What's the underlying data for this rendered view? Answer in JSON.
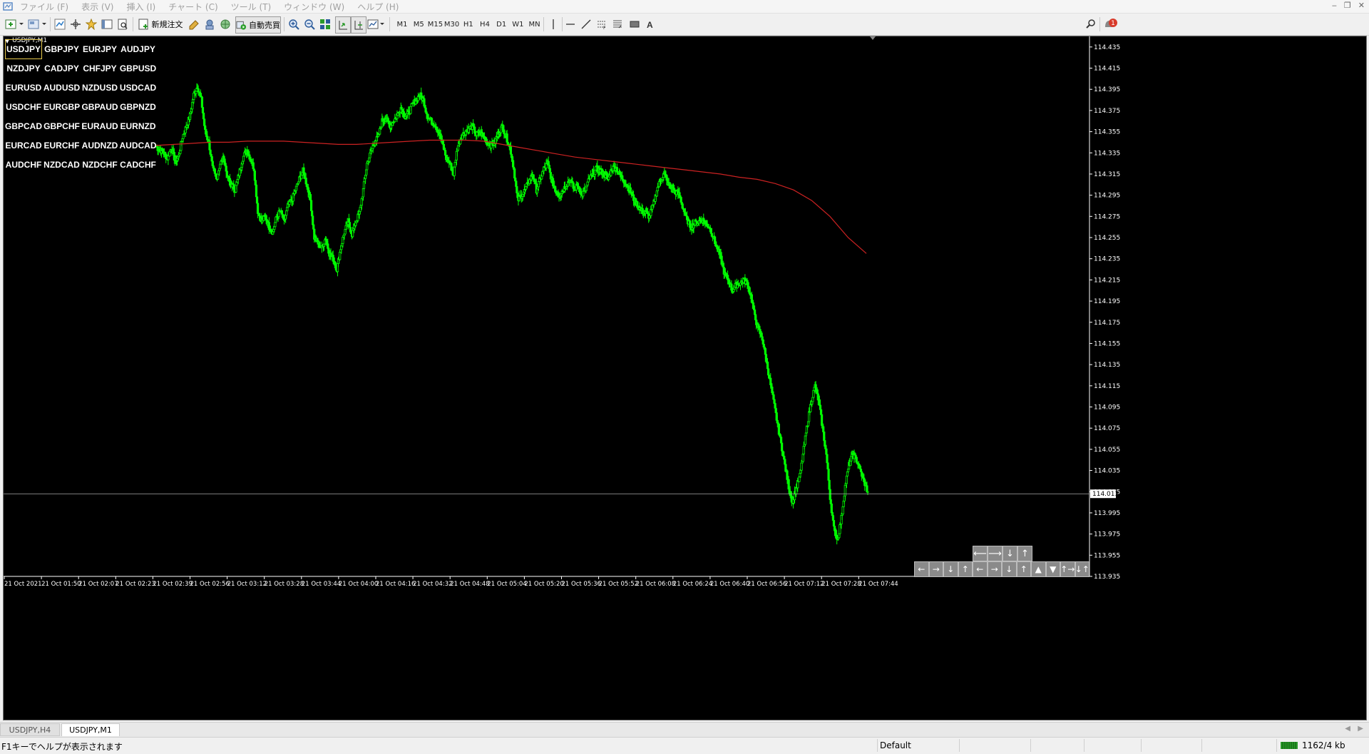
{
  "menus": [
    "ファイル (F)",
    "表示 (V)",
    "挿入 (I)",
    "チャート (C)",
    "ツール (T)",
    "ウィンドウ (W)",
    "ヘルプ (H)"
  ],
  "toolbar": {
    "new_order_label": "新規注文",
    "auto_trade_label": "自動売買",
    "timeframes": [
      "M1",
      "M5",
      "M15",
      "M30",
      "H1",
      "H4",
      "D1",
      "W1",
      "MN"
    ],
    "notification_count": "1"
  },
  "chart": {
    "title": "USDJPY,M1",
    "current_price": "114.013",
    "price_ticks": [
      "114.435",
      "114.415",
      "114.395",
      "114.375",
      "114.355",
      "114.335",
      "114.315",
      "114.295",
      "114.275",
      "114.255",
      "114.235",
      "114.215",
      "114.195",
      "114.175",
      "114.155",
      "114.135",
      "114.115",
      "114.095",
      "114.075",
      "114.055",
      "114.035",
      "114.015",
      "113.995",
      "113.975",
      "113.955",
      "113.935"
    ],
    "time_ticks": [
      "21 Oct 2021",
      "21 Oct 01:50",
      "21 Oct 02:07",
      "21 Oct 02:23",
      "21 Oct 02:39",
      "21 Oct 02:56",
      "21 Oct 03:12",
      "21 Oct 03:28",
      "21 Oct 03:44",
      "21 Oct 04:00",
      "21 Oct 04:16",
      "21 Oct 04:32",
      "21 Oct 04:48",
      "21 Oct 05:04",
      "21 Oct 05:20",
      "21 Oct 05:36",
      "21 Oct 05:52",
      "21 Oct 06:08",
      "21 Oct 06:24",
      "21 Oct 06:40",
      "21 Oct 06:56",
      "21 Oct 07:12",
      "21 Oct 07:28",
      "21 Oct 07:44"
    ],
    "candle_color": "#00ff00",
    "ma_color": "#cc2222",
    "price_path": [
      114.341,
      114.338,
      114.335,
      114.33,
      114.34,
      114.328,
      114.332,
      114.35,
      114.36,
      114.37,
      114.39,
      114.398,
      114.385,
      114.355,
      114.345,
      114.32,
      114.31,
      114.325,
      114.33,
      114.31,
      114.305,
      114.3,
      114.315,
      114.33,
      114.338,
      114.33,
      114.32,
      114.28,
      114.27,
      114.275,
      114.265,
      114.26,
      114.275,
      114.28,
      114.27,
      114.285,
      114.29,
      114.3,
      114.31,
      114.318,
      114.305,
      114.29,
      114.255,
      114.25,
      114.245,
      114.255,
      114.24,
      114.235,
      114.225,
      114.245,
      114.26,
      114.27,
      114.258,
      114.27,
      114.278,
      114.3,
      114.325,
      114.335,
      114.345,
      114.35,
      114.365,
      114.368,
      114.36,
      114.365,
      114.37,
      114.378,
      114.37,
      114.372,
      114.38,
      114.385,
      114.39,
      114.385,
      114.37,
      114.365,
      114.362,
      114.355,
      114.345,
      114.33,
      114.325,
      114.315,
      114.34,
      114.35,
      114.355,
      114.358,
      114.36,
      114.352,
      114.355,
      114.35,
      114.345,
      114.342,
      114.345,
      114.355,
      114.36,
      114.35,
      114.34,
      114.32,
      114.29,
      114.295,
      114.3,
      114.308,
      114.315,
      114.3,
      114.31,
      114.32,
      114.325,
      114.31,
      114.3,
      114.295,
      114.3,
      114.305,
      114.31,
      114.3,
      114.305,
      114.295,
      114.3,
      114.31,
      114.315,
      114.32,
      114.318,
      114.315,
      114.31,
      114.32,
      114.322,
      114.315,
      114.31,
      114.305,
      114.298,
      114.29,
      114.285,
      114.28,
      114.278,
      114.275,
      114.285,
      114.3,
      114.31,
      114.315,
      114.305,
      114.3,
      114.298,
      114.295,
      114.282,
      114.272,
      114.265,
      114.268,
      114.27,
      114.272,
      114.268,
      114.265,
      114.255,
      114.245,
      114.235,
      114.22,
      114.215,
      114.205,
      114.21,
      114.212,
      114.215,
      114.212,
      114.2,
      114.18,
      114.168,
      114.16,
      114.14,
      114.12,
      114.1,
      114.08,
      114.06,
      114.04,
      114.02,
      114.005,
      114.018,
      114.03,
      114.055,
      114.08,
      114.1,
      114.115,
      114.1,
      114.075,
      114.05,
      114.01,
      113.98,
      113.97,
      113.99,
      114.02,
      114.04,
      114.05,
      114.045,
      114.035,
      114.025,
      114.015
    ],
    "ma_path": [
      114.342,
      114.343,
      114.344,
      114.345,
      114.345,
      114.346,
      114.346,
      114.346,
      114.345,
      114.344,
      114.343,
      114.343,
      114.344,
      114.345,
      114.346,
      114.347,
      114.347,
      114.347,
      114.346,
      114.343,
      114.34,
      114.337,
      114.334,
      114.331,
      114.329,
      114.327,
      114.325,
      114.323,
      114.321,
      114.319,
      114.317,
      114.315,
      114.312,
      114.31,
      114.306,
      114.3,
      114.29,
      114.275,
      114.255,
      114.24
    ],
    "crosshair_price": 114.013,
    "y_range": [
      113.935,
      114.445
    ]
  },
  "symbols": [
    [
      "USDJPY",
      "GBPJPY",
      "EURJPY",
      "AUDJPY"
    ],
    [
      "NZDJPY",
      "CADJPY",
      "CHFJPY",
      "GBPUSD"
    ],
    [
      "EURUSD",
      "AUDUSD",
      "NZDUSD",
      "USDCAD"
    ],
    [
      "USDCHF",
      "EURGBP",
      "GBPAUD",
      "GBPNZD"
    ],
    [
      "GBPCAD",
      "GBPCHF",
      "EURAUD",
      "EURNZD"
    ],
    [
      "EURCAD",
      "EURCHF",
      "AUDNZD",
      "AUDCAD"
    ],
    [
      "AUDCHF",
      "NZDCAD",
      "NZDCHF",
      "CADCHF"
    ]
  ],
  "nav_top": [
    "⟵",
    "⟶",
    "↓",
    "↑"
  ],
  "nav_bottom": [
    "←",
    "→",
    "↓",
    "↑",
    "←",
    "→",
    "↓",
    "↑",
    "▲",
    "▼",
    "↑→",
    "↓↑"
  ],
  "tabs": [
    "USDJPY,H4",
    "USDJPY,M1"
  ],
  "status": {
    "help_text": "F1キーでヘルプが表示されます",
    "profile": "Default",
    "traffic": "1162/4 kb"
  }
}
